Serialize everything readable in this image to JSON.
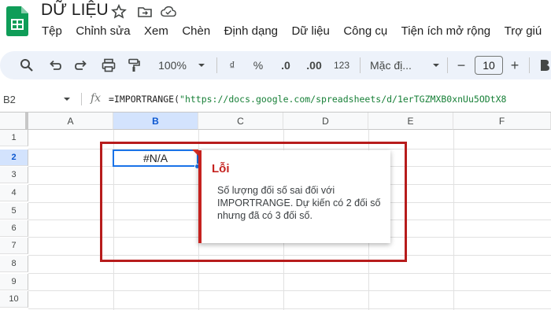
{
  "app": {
    "title": "DỮ LIỆU",
    "icons": [
      "star-icon",
      "move-to-folder-icon",
      "cloud-saved-icon"
    ]
  },
  "menu": [
    "Tệp",
    "Chỉnh sửa",
    "Xem",
    "Chèn",
    "Định dạng",
    "Dữ liệu",
    "Công cụ",
    "Tiện ích mở rộng",
    "Trợ giú"
  ],
  "toolbar": {
    "zoom": "100%",
    "currency": "₫",
    "percent": "%",
    "decrease_decimal": ".0",
    "increase_decimal": ".00",
    "number_format": "123",
    "font": "Mặc đị...",
    "font_size": "10",
    "minus": "−",
    "plus": "+"
  },
  "formula_bar": {
    "cell_ref": "B2",
    "fx": "fx",
    "formula_prefix": "=IMPORTRANGE(",
    "formula_string": "\"https://docs.google.com/spreadsheets/d/1erTGZMXB0xnUu5ODtX8"
  },
  "grid": {
    "columns": [
      "A",
      "B",
      "C",
      "D",
      "E",
      "F"
    ],
    "rows": [
      "1",
      "2",
      "3",
      "4",
      "5",
      "6",
      "7",
      "8",
      "9",
      "10"
    ],
    "active_cell_value": "#N/A"
  },
  "error_popup": {
    "title": "Lỗi",
    "message": "Số lượng đối số sai đối với IMPORTRANGE. Dự kiến có 2 đối số nhưng đã có 3 đối số."
  },
  "colors": {
    "accent": "#1a73e8",
    "error": "#c5221f",
    "annotation": "#b71c1c",
    "toolbar_bg": "#edf2fa"
  }
}
